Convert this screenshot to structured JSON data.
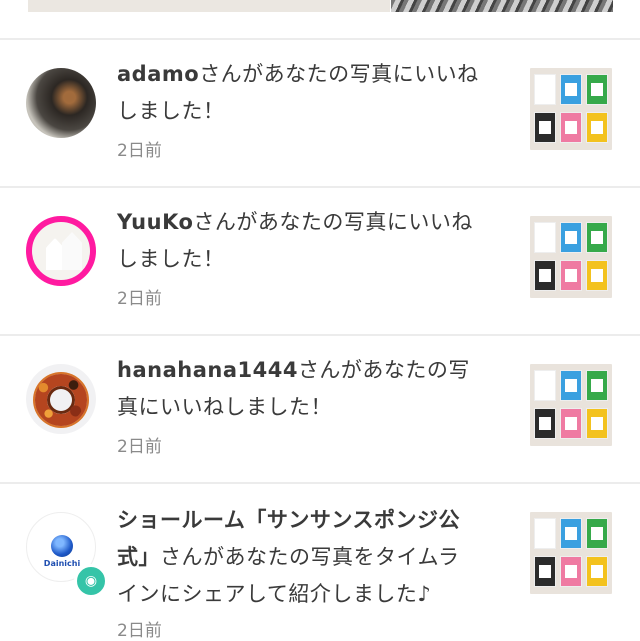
{
  "notifications": [
    {
      "user": "adamo",
      "text_line1": "さんがあなたの写真にいいね",
      "text_line2": "しました！",
      "time": "2日前",
      "avatar_icon": "sphere-lamp-avatar",
      "has_camera_badge": false
    },
    {
      "user": "YuuKo",
      "text_line1": "さんがあなたの写真にいいね",
      "text_line2": "しました！",
      "time": "2日前",
      "avatar_icon": "white-houses-avatar",
      "has_camera_badge": false
    },
    {
      "user": "hanahana1444",
      "text_line1": "さんがあなたの写",
      "text_line2": "真にいいねしました！",
      "time": "2日前",
      "avatar_icon": "wreath-avatar",
      "has_camera_badge": false
    },
    {
      "user_line1": "ショールーム「サンサンスポンジ公",
      "user_line2": "式」",
      "text_line2": "さんがあなたの写真をタイムラ",
      "text_line3": "インにシェアして紹介しました♪",
      "time": "2日前",
      "avatar_icon": "dainichi-logo-avatar",
      "has_camera_badge": true,
      "brand_text": "Dainichi"
    }
  ],
  "colors": {
    "accent_pink": "#ff1aa0",
    "badge_green": "#35c4a8",
    "divider": "#ececec",
    "thumb_packets": [
      "#ffffff",
      "#3aa0e0",
      "#36a94a",
      "#2b2b2b",
      "#ef7aa2",
      "#f3c21e"
    ]
  }
}
